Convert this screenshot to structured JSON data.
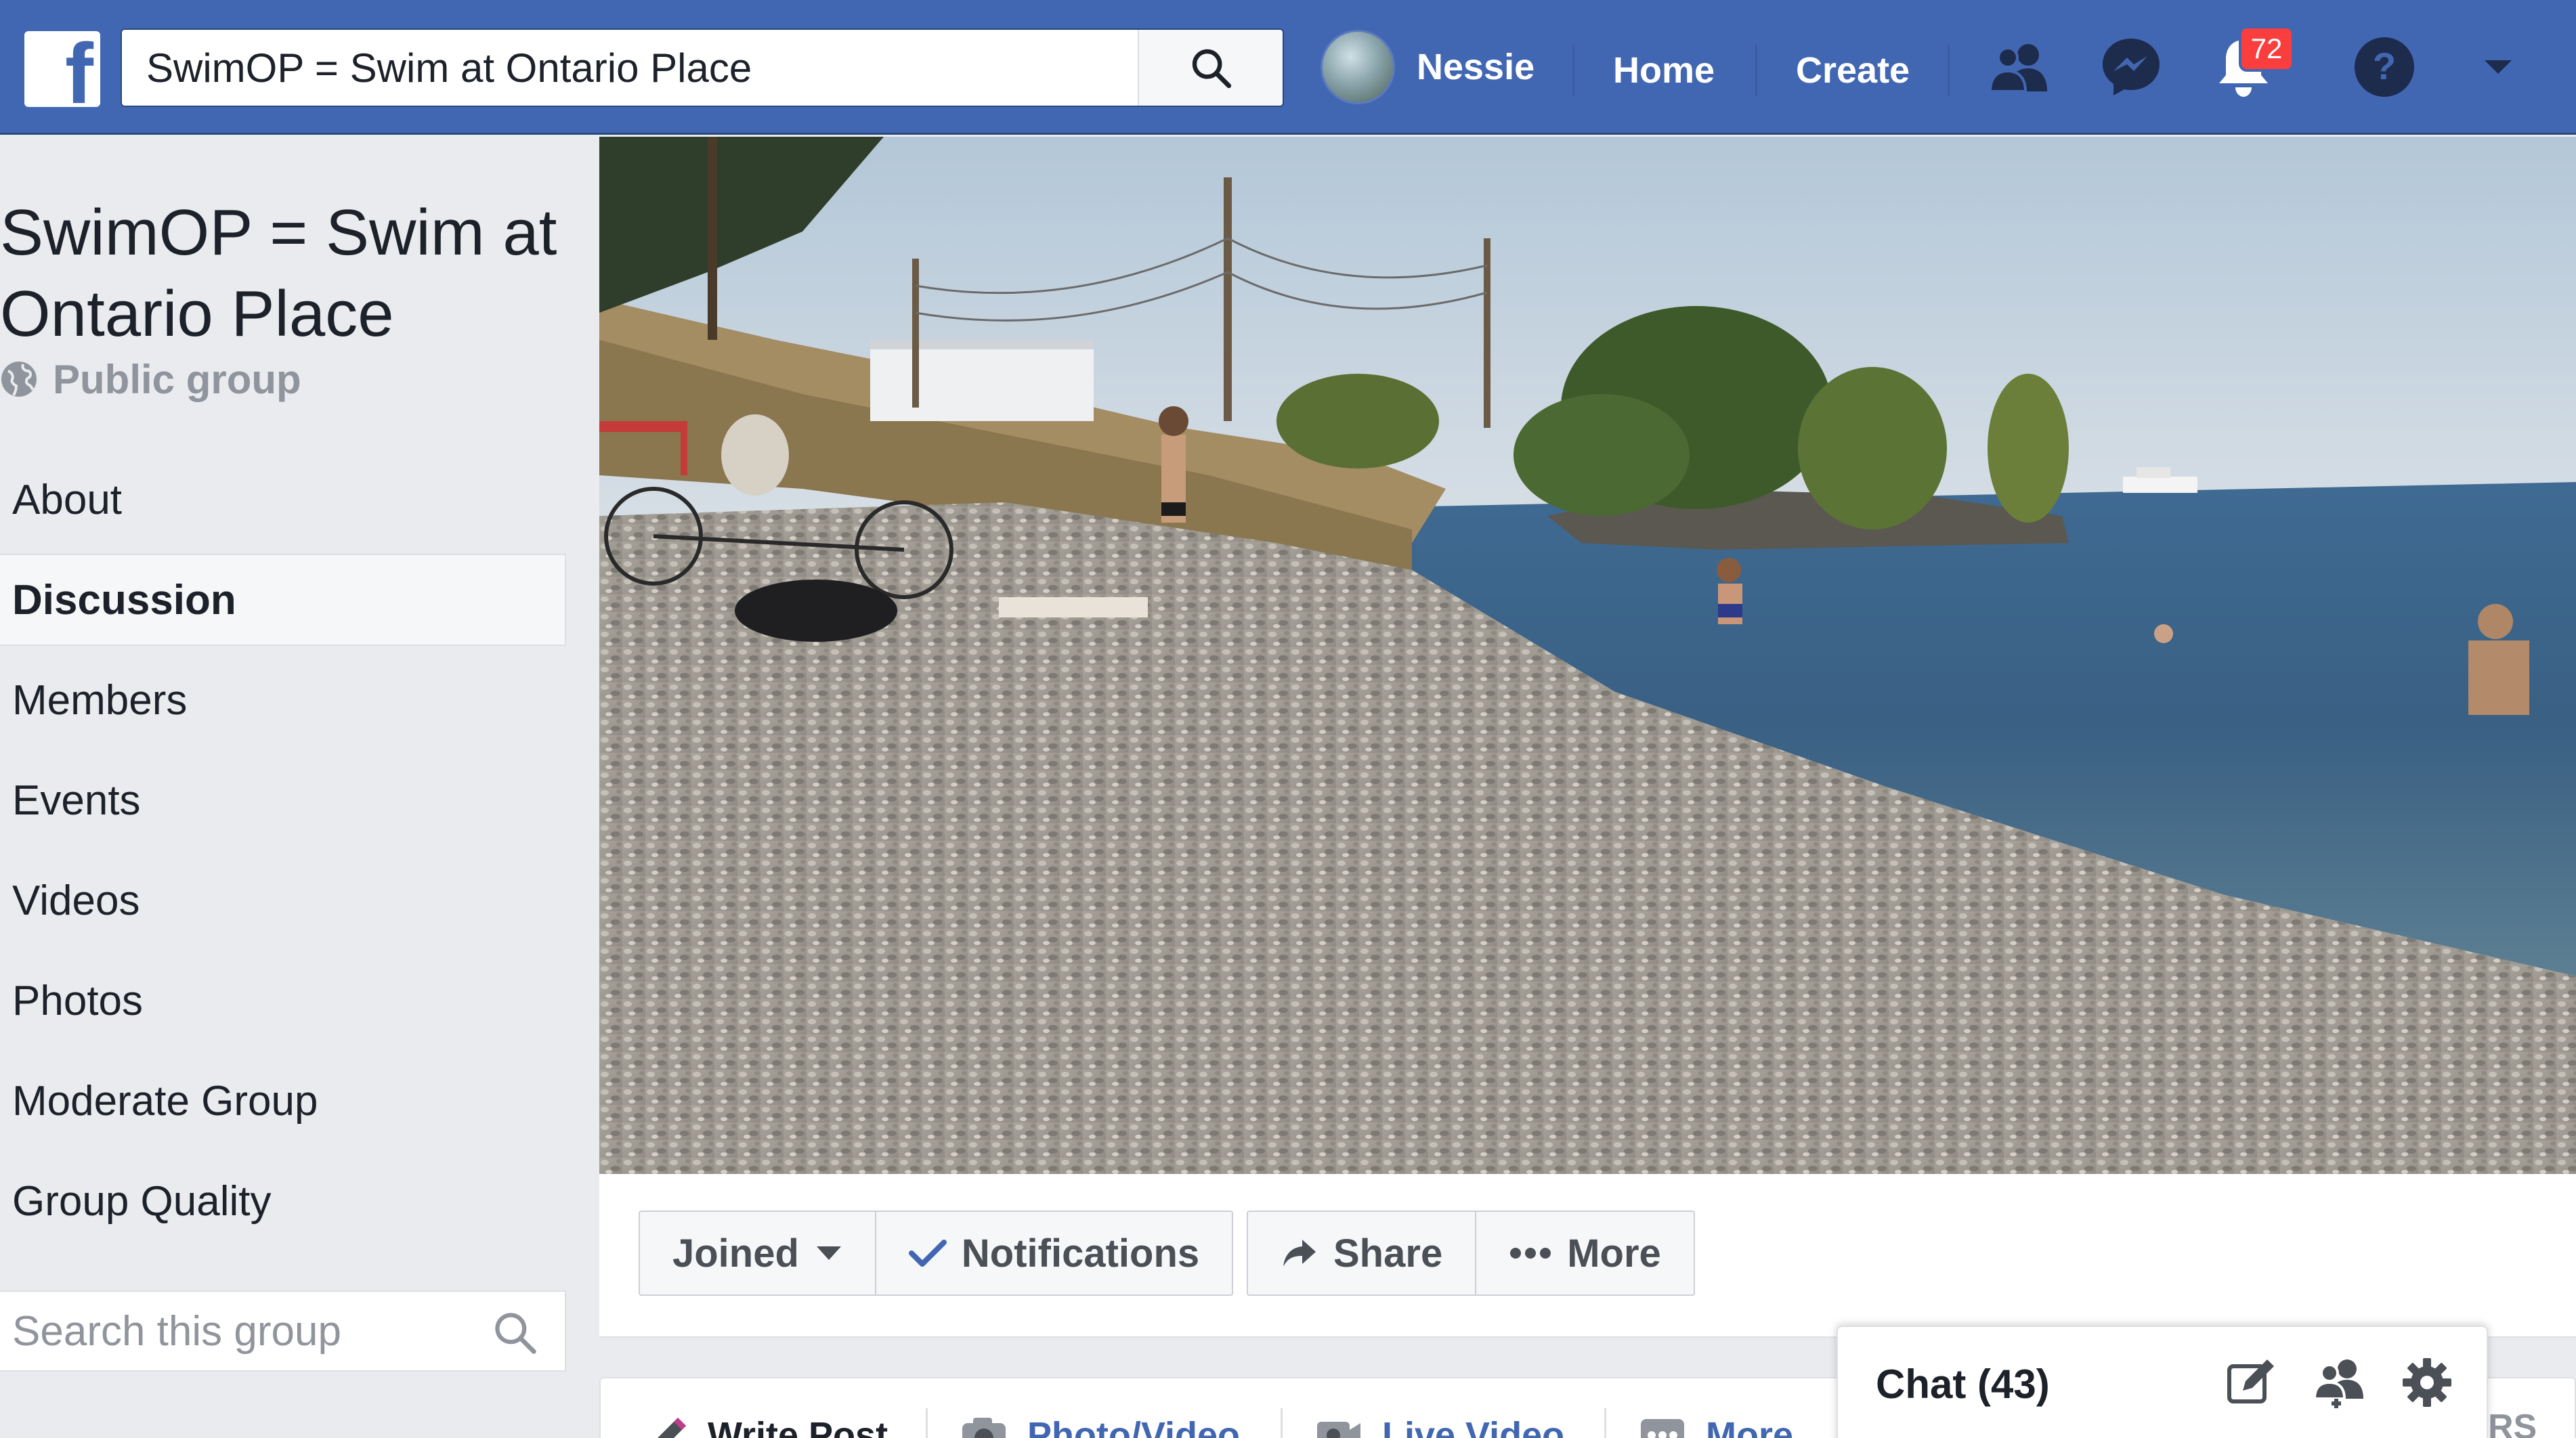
{
  "topbar": {
    "search_value": "SwimOP = Swim at Ontario Place",
    "profile_name": "Nessie",
    "home_label": "Home",
    "create_label": "Create",
    "notification_count": "72",
    "brand_color": "#4267b2"
  },
  "group": {
    "title": "SwimOP = Swim at Ontario Place",
    "privacy": "Public group"
  },
  "sidebar": {
    "items": [
      {
        "label": "About"
      },
      {
        "label": "Discussion"
      },
      {
        "label": "Members"
      },
      {
        "label": "Events"
      },
      {
        "label": "Videos"
      },
      {
        "label": "Photos"
      },
      {
        "label": "Moderate Group"
      },
      {
        "label": "Group Quality"
      }
    ],
    "active_item": "Discussion",
    "search_placeholder": "Search this group"
  },
  "actions": {
    "joined": "Joined",
    "notifications": "Notifications",
    "share": "Share",
    "more": "More"
  },
  "composer": {
    "tabs": [
      {
        "label": "Write Post",
        "icon": "pencil-icon"
      },
      {
        "label": "Photo/Video",
        "icon": "camera-icon"
      },
      {
        "label": "Live Video",
        "icon": "video-camera-icon"
      },
      {
        "label": "More",
        "icon": "ellipsis-icon"
      }
    ],
    "partial_right_text": "RS"
  },
  "chat": {
    "label": "Chat (43)"
  }
}
